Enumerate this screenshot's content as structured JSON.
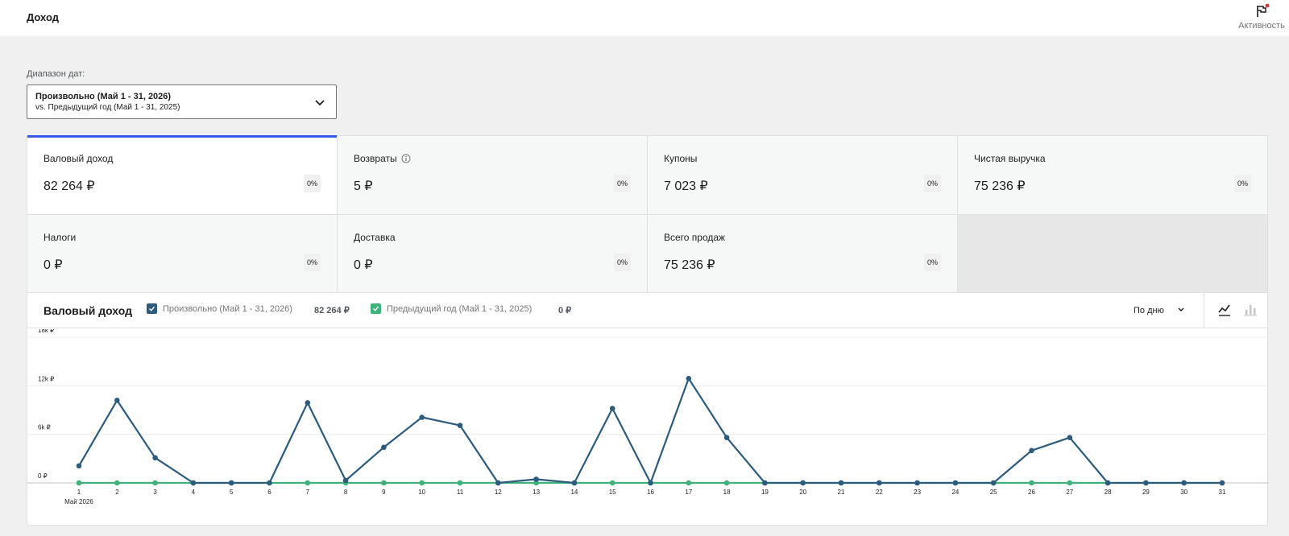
{
  "header": {
    "title": "Доход",
    "activity_label": "Активность"
  },
  "date_range": {
    "label": "Диапазон дат:",
    "primary": "Произвольно (Май 1 - 31, 2026)",
    "compare": "vs. Предыдущий год (Май 1 - 31, 2025)"
  },
  "cards": [
    {
      "label": "Валовый доход",
      "value": "82 264 ₽",
      "delta": "0%",
      "selected": true
    },
    {
      "label": "Возвраты",
      "value": "5 ₽",
      "delta": "0%",
      "info": true
    },
    {
      "label": "Купоны",
      "value": "7 023 ₽",
      "delta": "0%"
    },
    {
      "label": "Чистая выручка",
      "value": "75 236 ₽",
      "delta": "0%"
    },
    {
      "label": "Налоги",
      "value": "0 ₽",
      "delta": "0%"
    },
    {
      "label": "Доставка",
      "value": "0 ₽",
      "delta": "0%"
    },
    {
      "label": "Всего продаж",
      "value": "75 236 ₽",
      "delta": "0%"
    }
  ],
  "chart": {
    "title": "Валовый доход",
    "interval_label": "По дню",
    "legend": [
      {
        "name": "Произвольно (Май 1 - 31, 2026)",
        "total": "82 264 ₽",
        "color": "#2d5b7c"
      },
      {
        "name": "Предыдущий год (Май 1 - 31, 2025)",
        "total": "0 ₽",
        "color": "#3fb27a"
      }
    ]
  },
  "colors": {
    "accent": "#3858e9",
    "series_current": "#2d5b7c",
    "series_previous": "#3fb27a"
  },
  "icons": {
    "activity": "flag-icon",
    "chevron": "chevron-down-icon",
    "info": "info-icon",
    "line_chart": "line-chart-icon",
    "bar_chart": "bar-chart-icon"
  },
  "chart_data": {
    "type": "line",
    "x": [
      "1",
      "2",
      "3",
      "4",
      "5",
      "6",
      "7",
      "8",
      "9",
      "10",
      "11",
      "12",
      "13",
      "14",
      "15",
      "16",
      "17",
      "18",
      "19",
      "20",
      "21",
      "22",
      "23",
      "24",
      "25",
      "26",
      "27",
      "28",
      "29",
      "30",
      "31"
    ],
    "x_sublabel": "Май 2026",
    "y_ticks": [
      "0 ₽",
      "6k ₽",
      "12k ₽",
      "18k ₽"
    ],
    "ylim": [
      0,
      18000
    ],
    "grid": true,
    "series": [
      {
        "name": "Произвольно (Май 1 - 31, 2026)",
        "color": "#2d5b7c",
        "values": [
          2100,
          10200,
          3100,
          0,
          0,
          0,
          9900,
          300,
          4400,
          8100,
          7100,
          0,
          450,
          0,
          9200,
          0,
          12900,
          5600,
          0,
          0,
          0,
          0,
          0,
          0,
          0,
          4000,
          5600,
          0,
          0,
          0,
          0
        ]
      },
      {
        "name": "Предыдущий год (Май 1 - 31, 2025)",
        "color": "#3fb27a",
        "values": [
          0,
          0,
          0,
          0,
          0,
          0,
          0,
          0,
          0,
          0,
          0,
          0,
          0,
          0,
          0,
          0,
          0,
          0,
          0,
          0,
          0,
          0,
          0,
          0,
          0,
          0,
          0,
          0,
          0,
          0,
          0
        ]
      }
    ]
  }
}
